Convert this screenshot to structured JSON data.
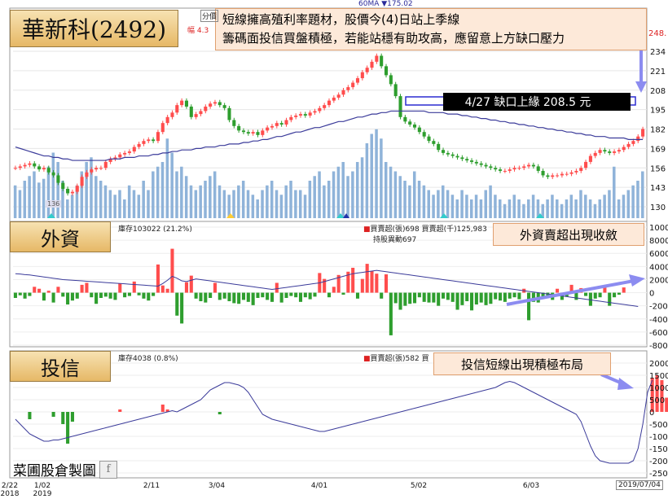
{
  "main": {
    "title": "華新科(2492)",
    "note_line1": "短線擁高殖利率題材，股價今(4)日站上季線",
    "note_line2": "籌碼面投信買盤積極，若能站穩有助攻高，應留意上方缺口壓力",
    "gap_label": "4/27 缺口上緣 208.5 元",
    "ma_legend": "60MA ▼175.02",
    "top_left_cut": "分價",
    "top_left_cut2": "幅 4.3",
    "top_right_tick": "248.",
    "price_ticks": [
      "234",
      "221",
      "208",
      "195",
      "182",
      "169",
      "156",
      "143",
      "130"
    ],
    "low_marker": "136"
  },
  "foreign": {
    "title": "外資",
    "header_left": "庫存103022 (21.2%)",
    "header_right": "買賣超(張)698 買賣超(千)125,983",
    "header_right2": "持股異動697",
    "callout": "外資賣超出現收斂",
    "ticks": [
      "10000",
      "8000",
      "6000",
      "4000",
      "2000",
      "0",
      "-2000",
      "-4000",
      "-6000",
      "-8000"
    ]
  },
  "trust": {
    "title": "投信",
    "header_left": "庫存4038 (0.8%)",
    "header_right": "買賣超(張)582 買",
    "callout": "投信短線出現積極布局",
    "ticks": [
      "2000",
      "1500",
      "1000",
      "500",
      "0",
      "-500",
      "-1000",
      "-1500",
      "-2000",
      "-2500"
    ]
  },
  "footer": {
    "watermark": "菜圃股倉製圖",
    "end_date": "2019/07/04"
  },
  "colors": {
    "up": "#ff4d4d",
    "down": "#2e9e2e",
    "volume": "#8fb3d9",
    "ma": "#3b3b9a",
    "arrow": "#8c8cf0"
  },
  "chart_data": [
    {
      "type": "candlestick",
      "title": "華新科(2492)",
      "x_ticks": [
        "2/22\n2018",
        "1/02\n2019",
        "2/11",
        "3/04",
        "4/01",
        "5/02",
        "6/03"
      ],
      "ylim": [
        124,
        250
      ],
      "close": [
        156,
        157,
        158,
        159,
        157,
        155,
        156,
        153,
        151,
        146,
        142,
        139,
        140,
        144,
        150,
        153,
        155,
        156,
        156,
        160,
        162,
        163,
        165,
        166,
        167,
        170,
        172,
        174,
        175,
        174,
        180,
        186,
        190,
        193,
        198,
        201,
        197,
        190,
        192,
        194,
        197,
        199,
        200,
        198,
        196,
        188,
        184,
        181,
        180,
        179,
        180,
        178,
        181,
        183,
        184,
        186,
        185,
        188,
        190,
        191,
        192,
        191,
        193,
        194,
        196,
        198,
        201,
        203,
        205,
        208,
        210,
        213,
        216,
        220,
        223,
        227,
        231,
        224,
        218,
        212,
        204,
        190,
        187,
        185,
        183,
        180,
        177,
        174,
        172,
        168,
        166,
        165,
        164,
        163,
        162,
        161,
        160,
        159,
        158,
        157,
        156,
        155,
        154,
        154,
        155,
        156,
        156,
        157,
        158,
        157,
        154,
        151,
        150,
        151,
        151,
        152,
        152,
        153,
        154,
        156,
        160,
        164,
        166,
        168,
        167,
        166,
        167,
        168,
        170,
        172,
        174,
        177,
        182
      ],
      "ma60": [
        170,
        169,
        168,
        167,
        166,
        165,
        164,
        164,
        163,
        163,
        162,
        162,
        161,
        161,
        161,
        161,
        161,
        161,
        161,
        161,
        162,
        162,
        162,
        163,
        163,
        163,
        164,
        164,
        164,
        165,
        165,
        166,
        166,
        167,
        167,
        168,
        168,
        168,
        169,
        169,
        170,
        170,
        170,
        171,
        171,
        172,
        172,
        172,
        173,
        173,
        174,
        174,
        175,
        175,
        176,
        177,
        177,
        178,
        179,
        180,
        180,
        181,
        182,
        183,
        183,
        184,
        185,
        186,
        187,
        187,
        188,
        189,
        190,
        190,
        191,
        192,
        192,
        193,
        193,
        194,
        194,
        194,
        194,
        194,
        194,
        194,
        194,
        193,
        193,
        193,
        193,
        192,
        192,
        192,
        191,
        191,
        190,
        190,
        189,
        189,
        188,
        188,
        187,
        187,
        186,
        186,
        185,
        185,
        184,
        184,
        183,
        183,
        182,
        182,
        181,
        181,
        180,
        180,
        179,
        179,
        178,
        178,
        177,
        177,
        177,
        176,
        176,
        176,
        176,
        175,
        175,
        175,
        175
      ],
      "volume_relative": [
        0.35,
        0.3,
        0.4,
        0.45,
        0.5,
        0.38,
        0.42,
        0.55,
        0.7,
        0.6,
        0.4,
        0.2,
        0.25,
        0.35,
        0.5,
        0.6,
        0.65,
        0.45,
        0.4,
        0.35,
        0.3,
        0.25,
        0.3,
        0.2,
        0.35,
        0.3,
        0.25,
        0.4,
        0.3,
        0.5,
        0.55,
        0.6,
        0.85,
        0.7,
        0.5,
        0.55,
        0.45,
        0.35,
        0.3,
        0.35,
        0.4,
        0.45,
        0.5,
        0.35,
        0.3,
        0.25,
        0.3,
        0.35,
        0.4,
        0.3,
        0.25,
        0.2,
        0.3,
        0.35,
        0.4,
        0.3,
        0.25,
        0.35,
        0.4,
        0.3,
        0.3,
        0.25,
        0.4,
        0.45,
        0.5,
        0.35,
        0.4,
        0.5,
        0.55,
        0.6,
        0.45,
        0.5,
        0.6,
        0.65,
        0.8,
        0.9,
        0.95,
        0.85,
        0.6,
        0.55,
        0.5,
        0.45,
        0.4,
        0.35,
        0.5,
        0.4,
        0.35,
        0.3,
        0.25,
        0.3,
        0.35,
        0.3,
        0.25,
        0.2,
        0.3,
        0.25,
        0.2,
        0.25,
        0.2,
        0.3,
        0.35,
        0.25,
        0.2,
        0.15,
        0.2,
        0.25,
        0.2,
        0.15,
        0.2,
        0.25,
        0.2,
        0.15,
        0.2,
        0.25,
        0.2,
        0.15,
        0.2,
        0.25,
        0.2,
        0.3,
        0.25,
        0.2,
        0.15,
        0.2,
        0.25,
        0.3,
        0.55,
        0.2,
        0.25,
        0.3,
        0.35,
        0.4,
        0.5
      ],
      "annotations": [
        "4/27 缺口上緣 208.5 元"
      ]
    },
    {
      "type": "bar",
      "title": "外資",
      "ylim": [
        -8000,
        10000
      ],
      "values": [
        -800,
        -400,
        -900,
        -500,
        900,
        600,
        -1200,
        300,
        -1500,
        900,
        -600,
        -1800,
        -1200,
        -900,
        1200,
        1500,
        -700,
        -1700,
        -800,
        -600,
        -900,
        -1100,
        1400,
        -700,
        -500,
        1700,
        -400,
        -900,
        -1200,
        -500,
        4300,
        1100,
        600,
        6700,
        -3500,
        -4700,
        1600,
        2600,
        -900,
        -1300,
        -1500,
        -800,
        1500,
        -1100,
        -900,
        -1300,
        -1600,
        -1700,
        -1100,
        -1400,
        -1900,
        -800,
        -700,
        -1100,
        -1400,
        1500,
        -1500,
        -800,
        -500,
        -700,
        -1400,
        -700,
        -1000,
        -600,
        3000,
        2100,
        -700,
        900,
        2700,
        -300,
        3200,
        3800,
        -900,
        2100,
        4400,
        3300,
        2900,
        -900,
        2800,
        -6500,
        -1600,
        -2600,
        -2000,
        -1700,
        -1600,
        -700,
        -1400,
        -1500,
        -1500,
        -2000,
        -900,
        -1100,
        -1400,
        -2600,
        -1900,
        -1300,
        -2700,
        -1800,
        -1500,
        -1900,
        -1700,
        -1000,
        -1200,
        -1400,
        -900,
        -700,
        -1000,
        600,
        -4200,
        -1400,
        -1500,
        -900,
        -700,
        -1100,
        600,
        -1100,
        -600,
        1200,
        -1100,
        700,
        -500,
        -2000,
        -900,
        -700,
        1100,
        -2000,
        -700,
        -300,
        800
      ],
      "line_relative": [
        2900,
        2850,
        2750,
        2700,
        2600,
        2500,
        2400,
        2300,
        2200,
        2100,
        2000,
        1950,
        1900,
        1850,
        1800,
        1750,
        1700,
        1650,
        1600,
        1550,
        1500,
        1450,
        1400,
        1350,
        1300,
        1250,
        1200,
        1150,
        1100,
        1050,
        1000,
        1400,
        1900,
        2500,
        2200,
        1800,
        1700,
        1900,
        2100,
        2000,
        1900,
        1800,
        1700,
        1600,
        1500,
        1400,
        1300,
        1200,
        1100,
        1000,
        900,
        800,
        700,
        600,
        500,
        600,
        700,
        800,
        900,
        1000,
        1100,
        1200,
        1300,
        1400,
        1500,
        1700,
        1900,
        2100,
        2300,
        2500,
        2700,
        2900,
        3000,
        3100,
        3200,
        3300,
        3400,
        3300,
        3200,
        3100,
        3000,
        2900,
        2800,
        2700,
        2600,
        2500,
        2400,
        2300,
        2200,
        2100,
        2000,
        1900,
        1800,
        1700,
        1600,
        1500,
        1400,
        1300,
        1200,
        1100,
        1000,
        900,
        800,
        700,
        600,
        500,
        400,
        300,
        200,
        100,
        0,
        -100,
        -200,
        -300,
        -400,
        -500,
        -600,
        -700,
        -800,
        -900,
        -1000,
        -1100,
        -1200,
        -1300,
        -1400,
        -1500,
        -1600,
        -1700,
        -1800,
        -1900,
        -2000,
        -2100
      ]
    },
    {
      "type": "bar",
      "title": "投信",
      "ylim": [
        -2500,
        2000
      ],
      "values": [
        0,
        0,
        0,
        -300,
        0,
        0,
        0,
        0,
        -200,
        0,
        -500,
        -1300,
        -400,
        0,
        0,
        0,
        0,
        0,
        0,
        0,
        0,
        0,
        100,
        0,
        0,
        0,
        0,
        0,
        0,
        0,
        0,
        300,
        100,
        0,
        0,
        0,
        0,
        0,
        0,
        0,
        0,
        0,
        0,
        -100,
        0,
        0,
        0,
        0,
        0,
        0,
        0,
        0,
        0,
        0,
        0,
        0,
        0,
        0,
        0,
        0,
        0,
        0,
        0,
        0,
        0,
        0,
        0,
        0,
        0,
        0,
        0,
        0,
        0,
        0,
        0,
        0,
        0,
        0,
        0,
        0,
        0,
        0,
        0,
        0,
        0,
        0,
        0,
        0,
        0,
        0,
        0,
        0,
        0,
        0,
        0,
        0,
        0,
        0,
        0,
        0,
        0,
        0,
        0,
        0,
        0,
        0,
        0,
        0,
        0,
        0,
        0,
        0,
        0,
        0,
        0,
        0,
        0,
        0,
        0,
        0,
        0,
        0,
        0,
        0,
        0,
        0,
        0,
        0,
        0,
        0,
        0,
        0,
        0,
        0,
        0,
        0,
        0,
        0
      ],
      "line_relative": [
        -300,
        -500,
        -700,
        -900,
        -1000,
        -1100,
        -1200,
        -1200,
        -1150,
        -1150,
        -1100,
        -1050,
        -1000,
        -950,
        -900,
        -850,
        -800,
        -750,
        -700,
        -650,
        -600,
        -550,
        -500,
        -450,
        -400,
        -350,
        -300,
        -250,
        -200,
        -150,
        -100,
        -50,
        0,
        50,
        0,
        100,
        200,
        300,
        400,
        500,
        700,
        900,
        1000,
        1100,
        1200,
        1200,
        1150,
        1100,
        1000,
        800,
        500,
        200,
        -100,
        -200,
        -300,
        -350,
        -400,
        -450,
        -500,
        -550,
        -600,
        -650,
        -700,
        -750,
        -800,
        -800,
        -750,
        -700,
        -650,
        -600,
        -550,
        -500,
        -450,
        -400,
        -350,
        -300,
        -250,
        -200,
        -150,
        -100,
        -50,
        0,
        50,
        100,
        150,
        200,
        250,
        300,
        350,
        400,
        450,
        500,
        550,
        600,
        650,
        700,
        750,
        800,
        850,
        900,
        950,
        1000,
        1100,
        1200,
        1250,
        1200,
        1100,
        1000,
        900,
        800,
        700,
        600,
        500,
        400,
        300,
        200,
        100,
        0,
        -100,
        -400,
        -900,
        -1400,
        -1800,
        -2000,
        -2050,
        -2100,
        -2100,
        -2100,
        -2100,
        -2100,
        -2000,
        -1500,
        -500,
        800,
        1300
      ]
    }
  ]
}
